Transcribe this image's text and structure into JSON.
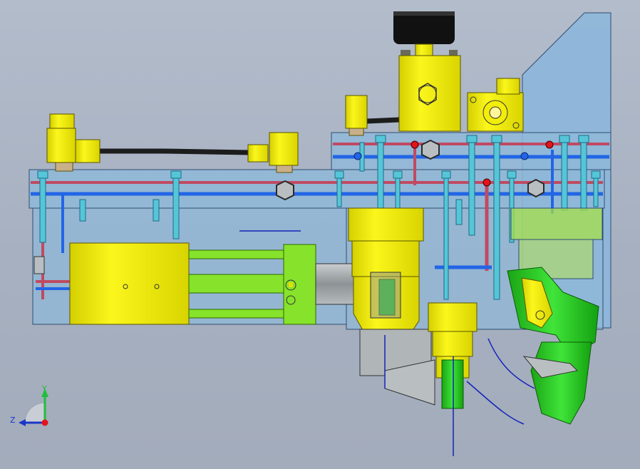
{
  "viewport": {
    "background_top": "#b3bccb",
    "background_bottom": "#a3acbb"
  },
  "triad": {
    "y_label": "Y",
    "z_label": "Z",
    "y_color": "#1fbf3a",
    "z_color": "#1a35c8",
    "origin_color": "#e3141b"
  },
  "part_colors": {
    "manifold_transparent": "#8fb8d8",
    "manifold_edge": "#2f4e70",
    "yellow_component": "#f5f00a",
    "green_component": "#22d11a",
    "lime_rod": "#86e22b",
    "channel_red": "#c04a62",
    "channel_blue": "#2265e6",
    "bolt_cyan": "#55c6d8",
    "hose_black": "#1d1d1d",
    "gauge_black": "#111111",
    "steel_gray": "#9ea4a8",
    "sketch_line": "#1323b8"
  },
  "icons": {
    "nut": "hex-nut-icon",
    "marker": "red-dot-icon",
    "port": "blue-port-icon"
  }
}
